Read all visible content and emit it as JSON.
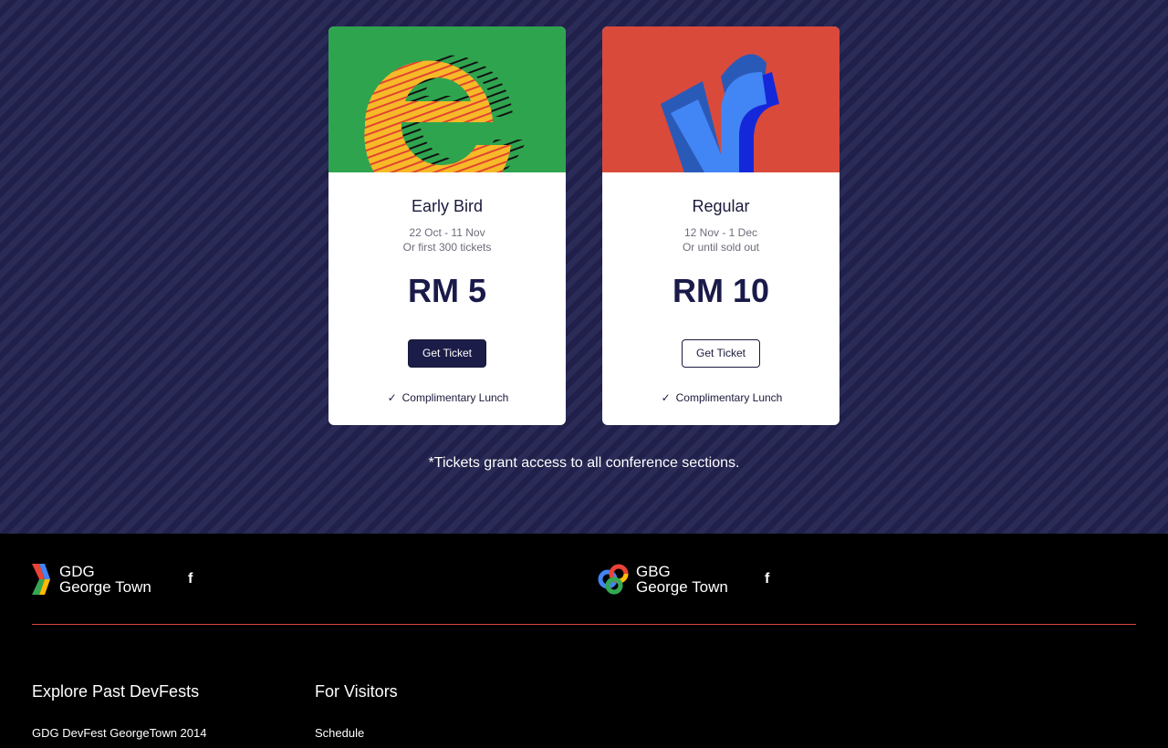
{
  "tickets": [
    {
      "title": "Early Bird",
      "dates": "22 Oct - 11 Nov",
      "condition": "Or first 300 tickets",
      "price": "RM 5",
      "button": "Get Ticket",
      "perk": "Complimentary Lunch",
      "art_bg": "#2fa44f"
    },
    {
      "title": "Regular",
      "dates": "12 Nov - 1 Dec",
      "condition": "Or until sold out",
      "price": "RM 10",
      "button": "Get Ticket",
      "perk": "Complimentary Lunch",
      "art_bg": "#d94a3b"
    }
  ],
  "note": "*Tickets grant access to all conference sections.",
  "footer": {
    "brand1": {
      "line1": "GDG",
      "line2": "George Town"
    },
    "brand2": {
      "line1": "GBG",
      "line2": "George Town"
    },
    "facebook_icon": "facebook-icon",
    "divider_color": "#d9473b",
    "columns": [
      {
        "heading": "Explore Past DevFests",
        "links": [
          "GDG DevFest GeorgeTown 2014"
        ]
      },
      {
        "heading": "For Visitors",
        "links": [
          "Schedule"
        ]
      }
    ]
  }
}
